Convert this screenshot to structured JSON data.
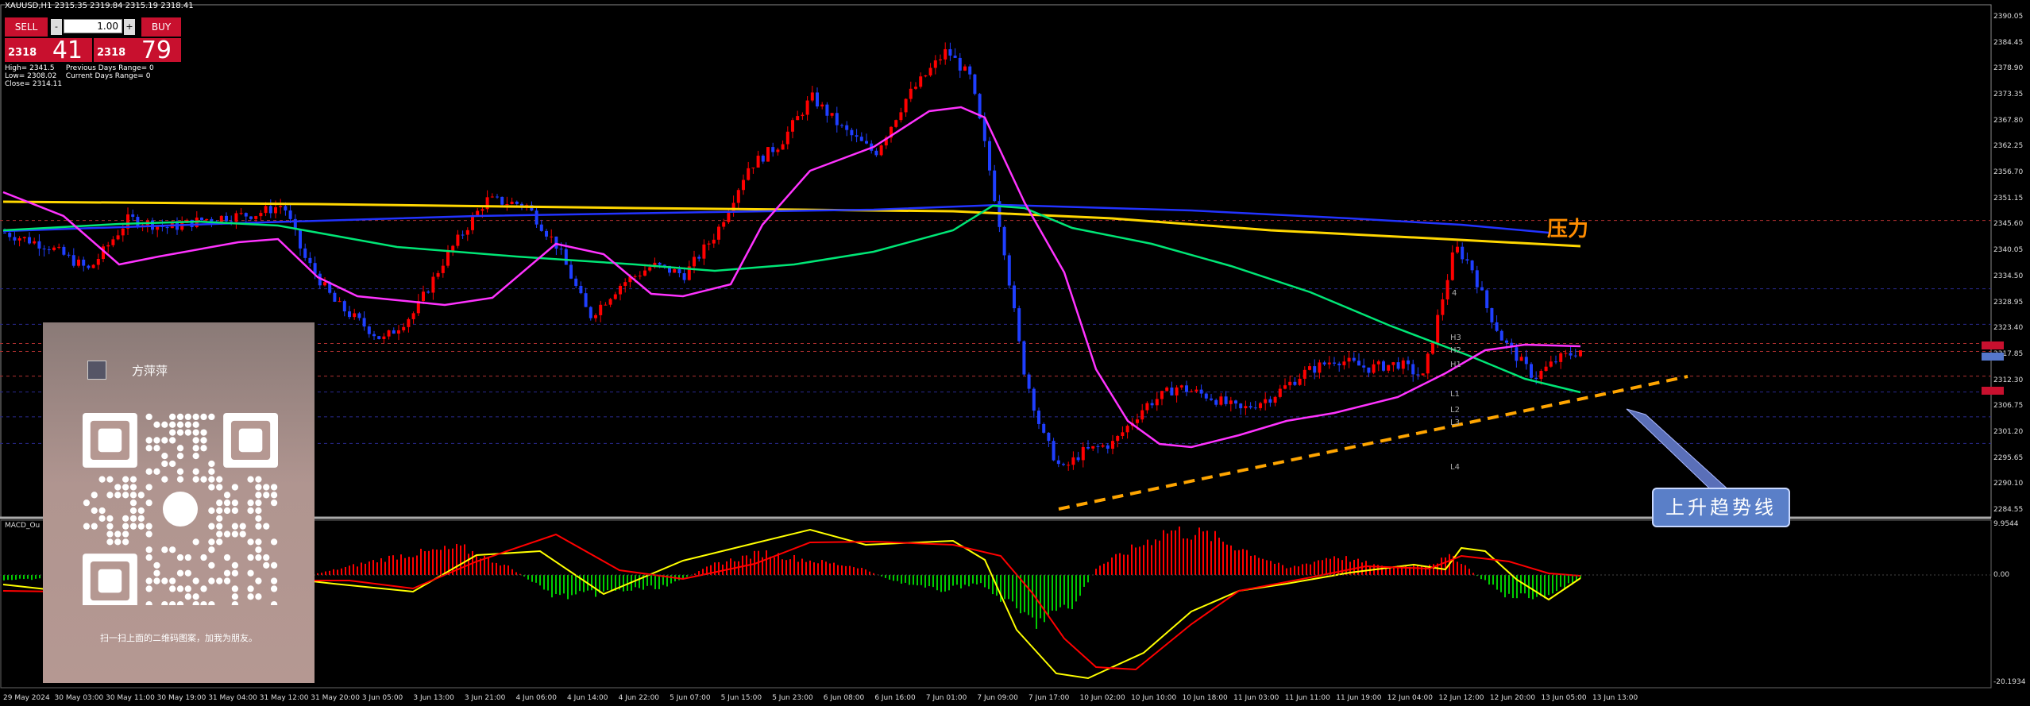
{
  "header": {
    "symbol_line": "XAUUSD,H1  2315.35 2319.84 2315.19 2318.41"
  },
  "trade_panel": {
    "sell_label": "SELL",
    "buy_label": "BUY",
    "lot_value": "1.00",
    "minus": "-",
    "plus": "+",
    "sell_small": "2318",
    "sell_big": "41",
    "buy_small": "2318",
    "buy_big": "79"
  },
  "stats": {
    "text": "High= 2341.5     Previous Days Range= 0\nLow= 2308.02    Current Days Range= 0\nClose= 2314.11"
  },
  "y_axis": [
    "2390.05",
    "2384.45",
    "2378.90",
    "2373.35",
    "2367.80",
    "2362.25",
    "2356.70",
    "2351.15",
    "2345.60",
    "2340.05",
    "2334.50",
    "2328.95",
    "2323.40",
    "2317.85",
    "2312.30",
    "2306.75",
    "2301.20",
    "2295.65",
    "2290.10",
    "2284.55"
  ],
  "x_axis": [
    "29 May 2024",
    "30 May 03:00",
    "30 May 11:00",
    "30 May 19:00",
    "31 May 04:00",
    "31 May 12:00",
    "31 May 20:00",
    "3 Jun 05:00",
    "3 Jun 13:00",
    "3 Jun 21:00",
    "4 Jun 06:00",
    "4 Jun 14:00",
    "4 Jun 22:00",
    "5 Jun 07:00",
    "5 Jun 15:00",
    "5 Jun 23:00",
    "6 Jun 08:00",
    "6 Jun 16:00",
    "7 Jun 01:00",
    "7 Jun 09:00",
    "7 Jun 17:00",
    "10 Jun 02:00",
    "10 Jun 10:00",
    "10 Jun 18:00",
    "11 Jun 03:00",
    "11 Jun 11:00",
    "11 Jun 19:00",
    "12 Jun 04:00",
    "12 Jun 12:00",
    "12 Jun 20:00",
    "13 Jun 05:00",
    "13 Jun 13:00"
  ],
  "macd": {
    "label": "MACD_Ou",
    "top_value": "9.9544",
    "zero_value": "0.00",
    "bottom_value": "-20.1934"
  },
  "pivots": {
    "h4": "4",
    "h3": "H3",
    "h2": "H2",
    "h1": "H1",
    "l1": "L1",
    "l2": "L2",
    "l3": "L3",
    "l4": "L4"
  },
  "annotations": {
    "pressure": "压力",
    "uptrend": "上升趋势线"
  },
  "overlay": {
    "name": "方萍萍",
    "caption": "扫一扫上面的二维码图案，加我为朋友。"
  },
  "colors": {
    "bull": "#ff0000",
    "bear": "#1f3fff",
    "yellow_ma": "#ffd700",
    "blue_ma": "#2233ff",
    "green_ma": "#00e676",
    "magenta_ma": "#ff33ff",
    "trendline": "#ffa500",
    "macd_signal": "#ffff00",
    "macd_main": "#ff0000"
  }
}
